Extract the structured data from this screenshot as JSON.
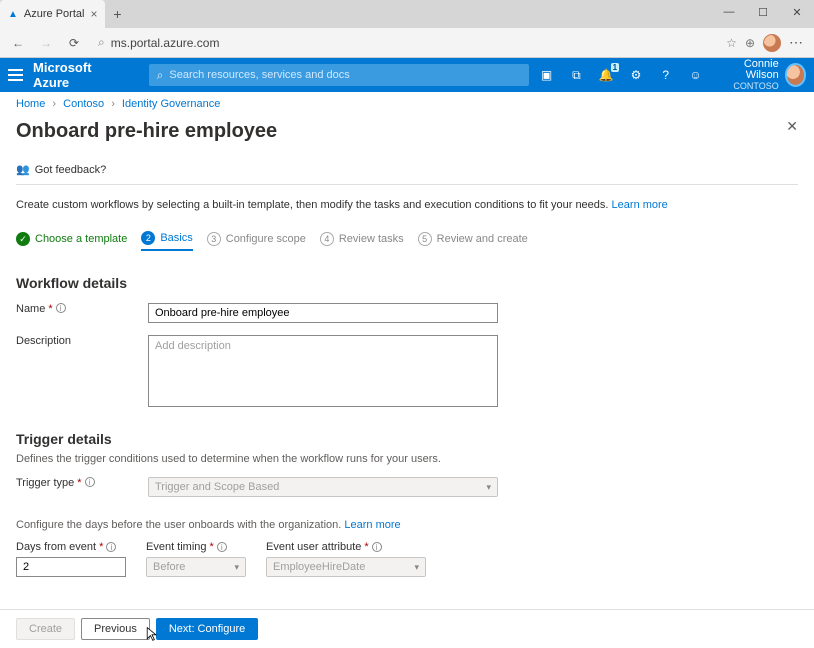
{
  "browser": {
    "tab_title": "Azure Portal",
    "url": "ms.portal.azure.com"
  },
  "azure": {
    "brand": "Microsoft Azure",
    "search_placeholder": "Search resources, services and docs",
    "notification_count": "1",
    "user_name": "Connie Wilson",
    "user_org": "CONTOSO"
  },
  "breadcrumb": {
    "home": "Home",
    "l2": "Contoso",
    "l3": "Identity Governance"
  },
  "page": {
    "title": "Onboard pre-hire employee",
    "feedback": "Got feedback?",
    "intro": "Create custom workflows by selecting a built-in template, then modify the tasks and execution conditions to fit your needs.",
    "learn_more": "Learn more"
  },
  "steps": {
    "s1": "Choose a template",
    "s2": "Basics",
    "s2_num": "2",
    "s3": "Configure scope",
    "s3_num": "3",
    "s4": "Review tasks",
    "s4_num": "4",
    "s5": "Review and create",
    "s5_num": "5"
  },
  "workflow": {
    "heading": "Workflow details",
    "name_label": "Name",
    "name_value": "Onboard pre-hire employee",
    "desc_label": "Description",
    "desc_placeholder": "Add description"
  },
  "trigger": {
    "heading": "Trigger details",
    "hint": "Defines the trigger conditions used to determine when the workflow runs for your users.",
    "type_label": "Trigger type",
    "type_value": "Trigger and Scope Based",
    "config_hint": "Configure the days before the user onboards with the organization.",
    "days_label": "Days from event",
    "days_value": "2",
    "timing_label": "Event timing",
    "timing_value": "Before",
    "attr_label": "Event user attribute",
    "attr_value": "EmployeeHireDate"
  },
  "footer": {
    "create": "Create",
    "previous": "Previous",
    "next": "Next: Configure"
  }
}
